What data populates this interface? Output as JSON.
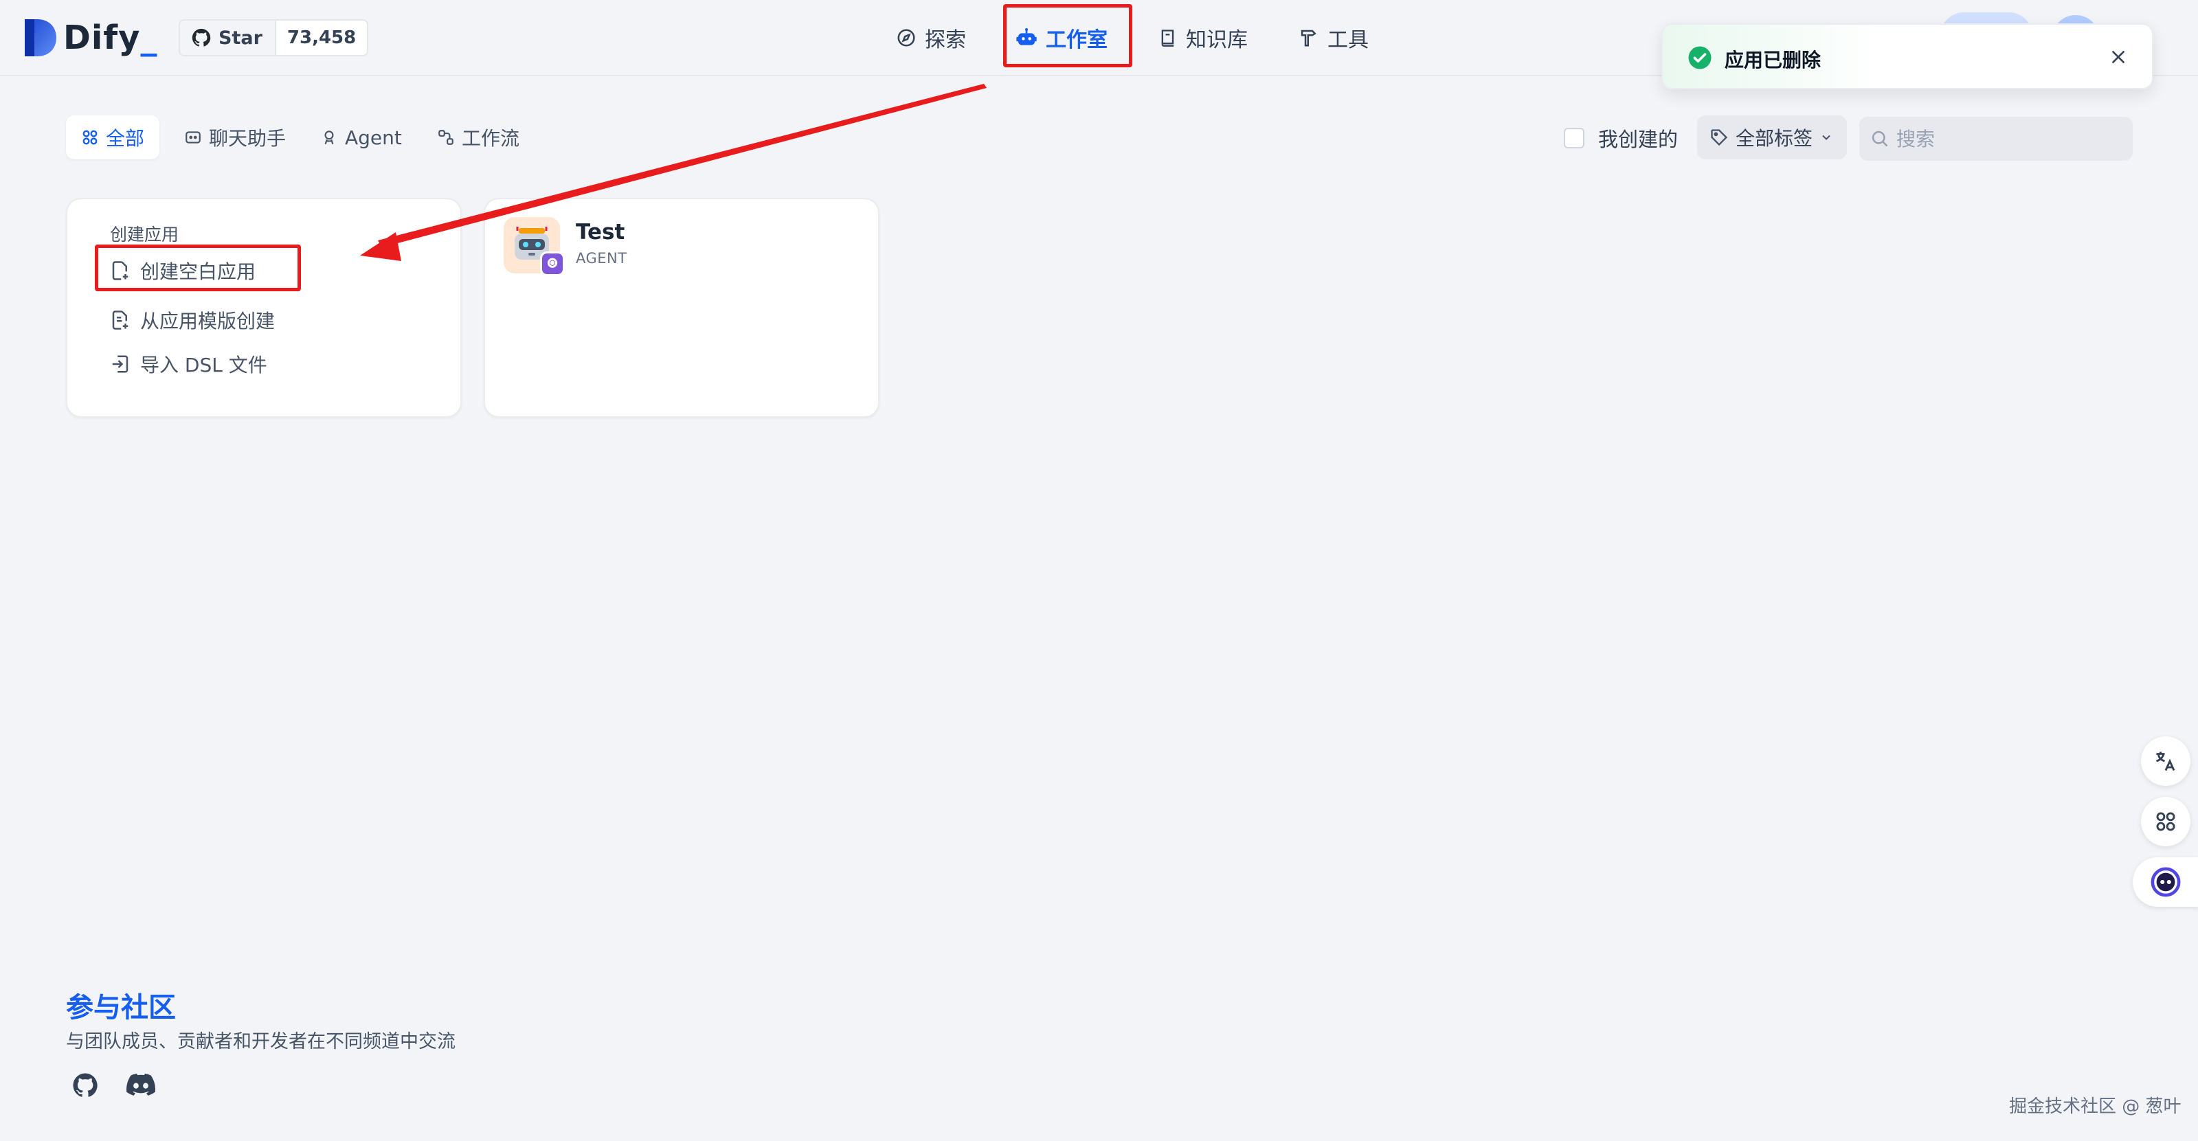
{
  "header": {
    "logo_text": "Dify",
    "github": {
      "star_label": "Star",
      "star_count": "73,458"
    },
    "nav": [
      {
        "label": "探索",
        "icon": "compass-icon"
      },
      {
        "label": "工作室",
        "icon": "robot-icon",
        "active": true
      },
      {
        "label": "知识库",
        "icon": "book-icon"
      },
      {
        "label": "工具",
        "icon": "hammer-icon"
      }
    ]
  },
  "toast": {
    "message": "应用已删除",
    "status": "success"
  },
  "tabs": [
    {
      "label": "全部",
      "icon": "grid-icon",
      "active": true
    },
    {
      "label": "聊天助手",
      "icon": "chat-bot-icon"
    },
    {
      "label": "Agent",
      "icon": "agent-icon"
    },
    {
      "label": "工作流",
      "icon": "workflow-icon"
    }
  ],
  "filters": {
    "mine_label": "我创建的",
    "mine_checked": false,
    "tags_label": "全部标签",
    "search_placeholder": "搜索"
  },
  "create_card": {
    "title": "创建应用",
    "items": [
      {
        "label": "创建空白应用",
        "icon": "file-plus-icon"
      },
      {
        "label": "从应用模版创建",
        "icon": "file-template-icon"
      },
      {
        "label": "导入 DSL 文件",
        "icon": "import-icon"
      }
    ]
  },
  "apps": [
    {
      "name": "Test",
      "type": "AGENT",
      "icon": "robot-avatar-icon"
    }
  ],
  "community": {
    "title": "参与社区",
    "subtitle": "与团队成员、贡献者和开发者在不同频道中交流"
  },
  "watermark": "掘金技术社区 @ 葱叶",
  "colors": {
    "accent": "#155eef",
    "annotation_red": "#e81c1c",
    "success": "#17b26a",
    "background": "#f2f4f7"
  }
}
